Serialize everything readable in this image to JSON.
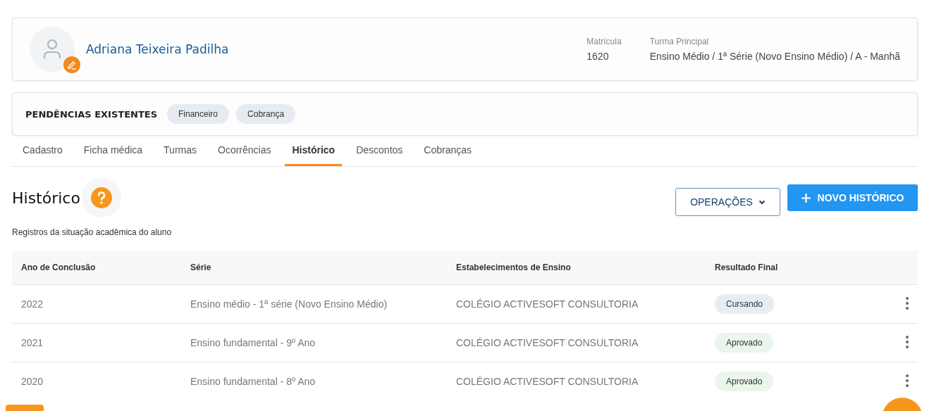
{
  "student": {
    "name": "Adriana Teixeira Padilha",
    "enrollment_label": "Matrícula",
    "enrollment": "1620",
    "class_label": "Turma Principal",
    "class": "Ensino Médio / 1ª Série (Novo Ensino Médio) / A - Manhã"
  },
  "pending": {
    "title": "PENDÊNCIAS EXISTENTES",
    "tags": [
      "Financeiro",
      "Cobrança"
    ]
  },
  "tabs": [
    {
      "label": "Cadastro",
      "selected": false
    },
    {
      "label": "Ficha médica",
      "selected": false
    },
    {
      "label": "Turmas",
      "selected": false
    },
    {
      "label": "Ocorrências",
      "selected": false
    },
    {
      "label": "Histórico",
      "selected": true
    },
    {
      "label": "Descontos",
      "selected": false
    },
    {
      "label": "Cobranças",
      "selected": false
    }
  ],
  "section": {
    "title": "Histórico",
    "subtitle": "Registros da situação acadêmica do aluno",
    "operations_button": "OPERAÇÕES",
    "new_button": "NOVO HISTÓRICO"
  },
  "table": {
    "columns": [
      "Ano de Conclusão",
      "Série",
      "Estabelecimentos de Ensino",
      "Resultado Final"
    ],
    "rows": [
      {
        "year": "2022",
        "grade": "Ensino médio - 1ª série (Novo Ensino Médio)",
        "school": "COLÉGIO ACTIVESOFT CONSULTORIA",
        "result": "Cursando",
        "color": "#e6edf4"
      },
      {
        "year": "2021",
        "grade": "Ensino fundamental - 9º Ano",
        "school": "COLÉGIO ACTIVESOFT CONSULTORIA",
        "result": "Aprovado",
        "color": "#eaf5ec"
      },
      {
        "year": "2020",
        "grade": "Ensino fundamental - 8º Ano",
        "school": "COLÉGIO ACTIVESOFT CONSULTORIA",
        "result": "Aprovado",
        "color": "#eaf5ec"
      }
    ]
  }
}
